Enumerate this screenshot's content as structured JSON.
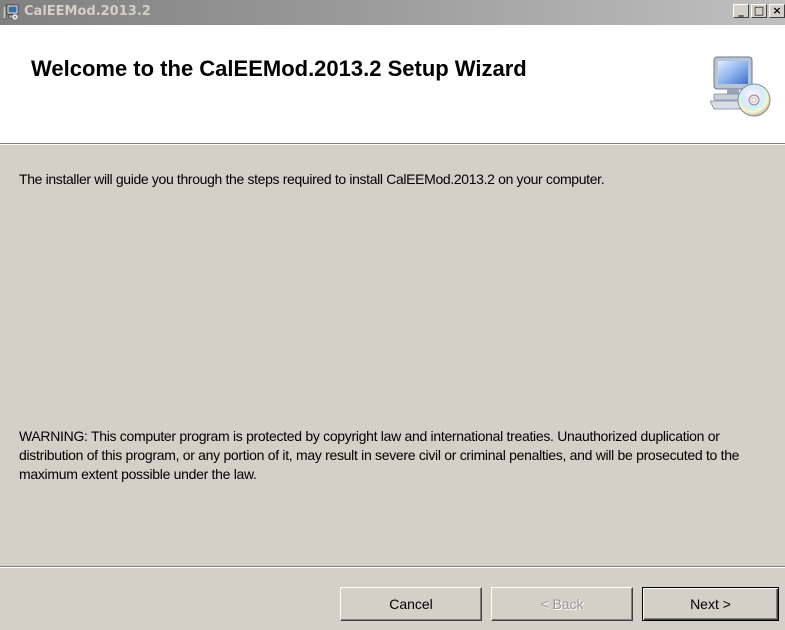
{
  "window": {
    "title": "CalEEMod.2013.2",
    "controls": {
      "minimize": "_",
      "maximize": "□",
      "close": "×"
    }
  },
  "header": {
    "title": "Welcome to the CalEEMod.2013.2 Setup Wizard",
    "icon": "computer-cd-setup-icon"
  },
  "body": {
    "intro": "The installer will guide you through the steps required to install CalEEMod.2013.2 on your computer.",
    "warning": "WARNING: This computer program is protected by copyright law and international treaties. Unauthorized duplication or distribution of this program, or any portion of it, may result in severe civil or criminal penalties, and will be prosecuted to the maximum extent possible under the law."
  },
  "buttons": {
    "cancel": "Cancel",
    "back": "< Back",
    "next": "Next >",
    "back_enabled": false
  },
  "colors": {
    "dialog_bg": "#d4d0c8",
    "header_bg": "#ffffff",
    "titlebar_inactive": "#808080"
  }
}
